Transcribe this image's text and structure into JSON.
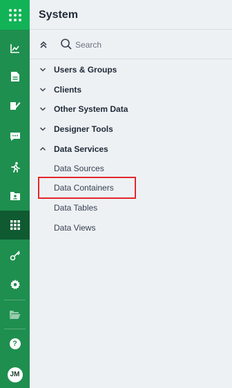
{
  "rail": {
    "user_initials": "JM",
    "help_glyph": "?",
    "items": [
      {
        "icon": "chart-line-icon"
      },
      {
        "icon": "document-icon"
      },
      {
        "icon": "edit-document-icon"
      },
      {
        "icon": "chat-icon"
      },
      {
        "icon": "runner-icon"
      },
      {
        "icon": "contact-folder-icon"
      },
      {
        "icon": "grid-icon",
        "active": true
      },
      {
        "icon": "key-icon"
      },
      {
        "icon": "gear-icon"
      },
      {
        "icon": "folder-open-icon"
      }
    ]
  },
  "header": {
    "title": "System"
  },
  "search": {
    "placeholder": "Search"
  },
  "nav": {
    "groups": [
      {
        "label": "Users & Groups",
        "expanded": false
      },
      {
        "label": "Clients",
        "expanded": false
      },
      {
        "label": "Other System Data",
        "expanded": false
      },
      {
        "label": "Designer Tools",
        "expanded": false
      },
      {
        "label": "Data Services",
        "expanded": true
      }
    ],
    "data_services_children": [
      {
        "label": "Data Sources"
      },
      {
        "label": "Data Containers",
        "highlighted": true
      },
      {
        "label": "Data Tables"
      },
      {
        "label": "Data Views"
      }
    ]
  },
  "colors": {
    "rail": "#1e8f4f",
    "rail_top": "#12b356",
    "rail_active": "#0f5a30",
    "highlight": "#e3262b"
  }
}
